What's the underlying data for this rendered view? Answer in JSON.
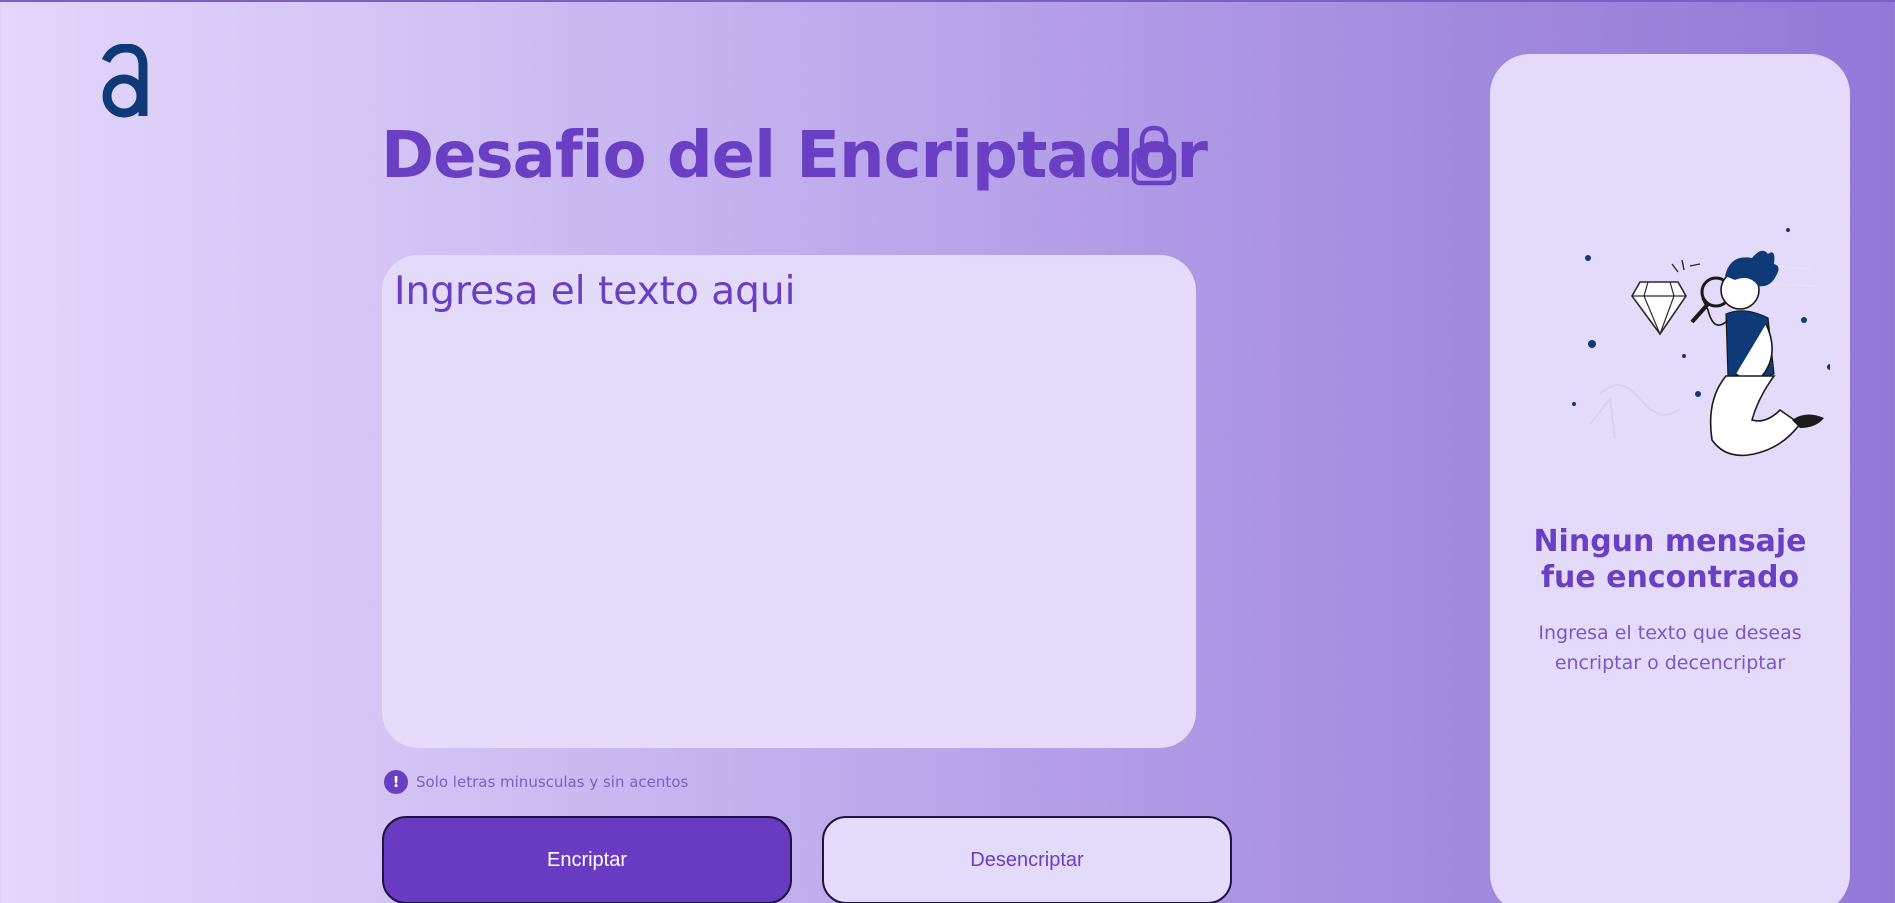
{
  "brand": {
    "logo_icon": "alura-logo-icon",
    "logo_color": "#0f3a78"
  },
  "header": {
    "title": "Desafio del Encriptador",
    "title_icon": "lock-icon"
  },
  "input": {
    "placeholder": "Ingresa el texto aqui",
    "value": ""
  },
  "hint": {
    "icon": "exclamation-circle-icon",
    "text": "Solo letras minusculas y sin acentos"
  },
  "actions": {
    "encrypt_label": "Encriptar",
    "decrypt_label": "Desencriptar"
  },
  "result": {
    "illustration": "searching-person-illustration",
    "title_line1": "Ningun mensaje",
    "title_line2": "fue encontrado",
    "subtitle_line1": "Ingresa el texto que deseas",
    "subtitle_line2": "encriptar o decencriptar"
  },
  "colors": {
    "accent": "#683bc2",
    "panel": "#e4daf9",
    "text_accent": "#6a3fc4",
    "dark_navy": "#0f3a78"
  }
}
